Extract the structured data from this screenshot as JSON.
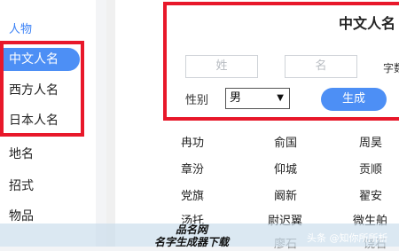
{
  "sidebar": {
    "category": "人物",
    "items": [
      {
        "label": "中文人名",
        "active": true
      },
      {
        "label": "西方人名"
      },
      {
        "label": "日本人名"
      },
      {
        "label": "地名"
      },
      {
        "label": "招式"
      },
      {
        "label": "物品"
      }
    ]
  },
  "form": {
    "title": "中文人名",
    "surname_placeholder": "姓",
    "given_placeholder": "名",
    "word_hint": "字数",
    "gender_label": "性别",
    "gender_value": "男",
    "generate_label": "生成"
  },
  "names": [
    [
      "冉功",
      "俞国",
      "周昊"
    ],
    [
      "章汾",
      "仰城",
      "贡顺"
    ],
    [
      "党旗",
      "阚新",
      "翟安"
    ],
    [
      "汤托",
      "尉迟翼",
      "微生舶"
    ],
    [
      "",
      "廖石",
      "饶石"
    ]
  ],
  "watermark": {
    "line1": "品名网",
    "line2": "名字生成器下载",
    "credit": "头条 @知你所所析"
  },
  "colors": {
    "accent": "#4d8ff5",
    "highlight": "#e8182a"
  }
}
